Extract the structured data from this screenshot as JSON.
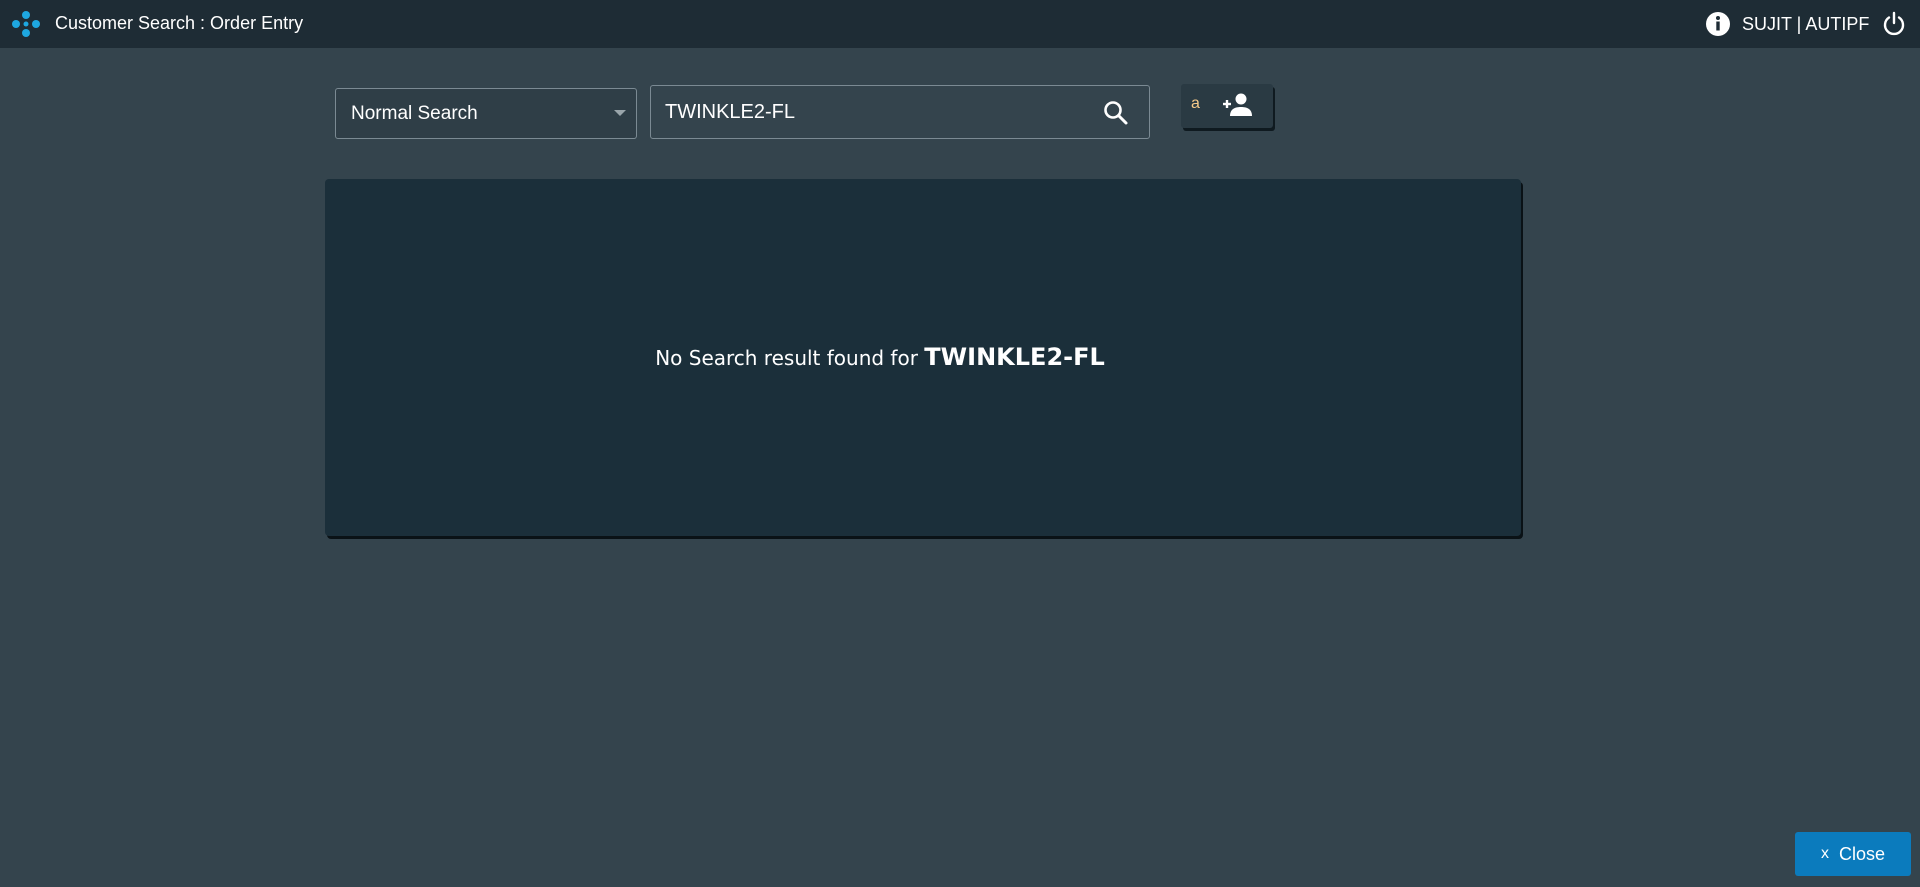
{
  "header": {
    "title": "Customer Search : Order Entry",
    "user": "SUJIT | AUTIPF",
    "icons": {
      "logo": "app-logo-icon",
      "info": "info-icon",
      "power": "power-icon"
    }
  },
  "search": {
    "mode": "Normal Search",
    "query": "TWINKLE2-FL",
    "search_icon": "search-icon",
    "add_button_letter": "a",
    "add_button_icon": "add-person-icon"
  },
  "results": {
    "empty_message": "No Search result found for",
    "empty_query": "TWINKLE2-FL"
  },
  "footer": {
    "close_x": "x",
    "close_label": "Close"
  },
  "colors": {
    "background": "#34444d",
    "topbar": "#1e2c35",
    "panel": "#1b2f3a",
    "accent": "#0b7bbd",
    "logo": "#1ea7e0"
  }
}
